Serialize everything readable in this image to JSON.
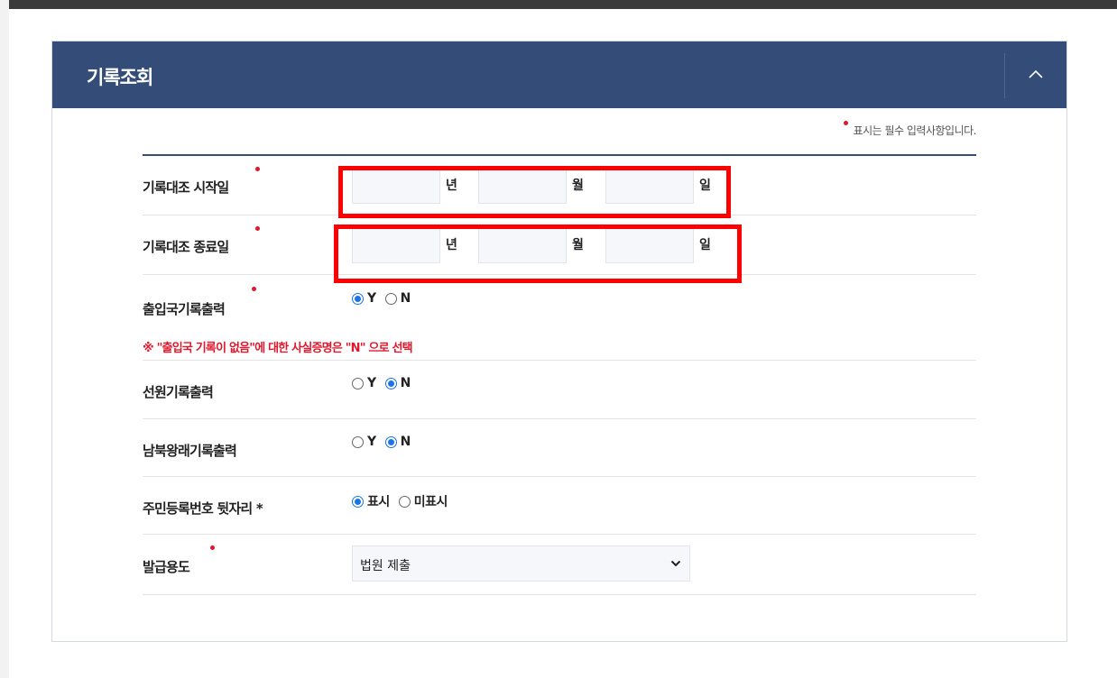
{
  "panel": {
    "title": "기록조회"
  },
  "required_note": "표시는 필수 입력사항입니다.",
  "form": {
    "start_date": {
      "label": "기록대조 시작일",
      "year_unit": "년",
      "month_unit": "월",
      "day_unit": "일",
      "year_value": "",
      "month_value": "",
      "day_value": ""
    },
    "end_date": {
      "label": "기록대조 종료일",
      "year_unit": "년",
      "month_unit": "월",
      "day_unit": "일",
      "year_value": "",
      "month_value": "",
      "day_value": ""
    },
    "immigration": {
      "label": "출입국기록출력",
      "yes": "Y",
      "no": "N",
      "selected": "Y"
    },
    "immigration_warning": "※ \"출입국 기록이 없음\"에 대한 사실증명은 \"N\" 으로 선택",
    "crew": {
      "label": "선원기록출력",
      "yes": "Y",
      "no": "N",
      "selected": "N"
    },
    "inter_korea": {
      "label": "남북왕래기록출력",
      "yes": "Y",
      "no": "N",
      "selected": "N"
    },
    "resident_number": {
      "label": "주민등록번호 뒷자리 *",
      "show": "표시",
      "hide": "미표시",
      "selected": "show"
    },
    "purpose": {
      "label": "발급용도",
      "selected": "법원 제출"
    }
  },
  "colors": {
    "header": "#344d78",
    "required": "#e0182d",
    "highlight": "#ff0000",
    "radio_selected": "#1a73e8"
  },
  "icons": {
    "collapse": "chevron-up-icon",
    "dropdown": "chevron-down-icon"
  }
}
